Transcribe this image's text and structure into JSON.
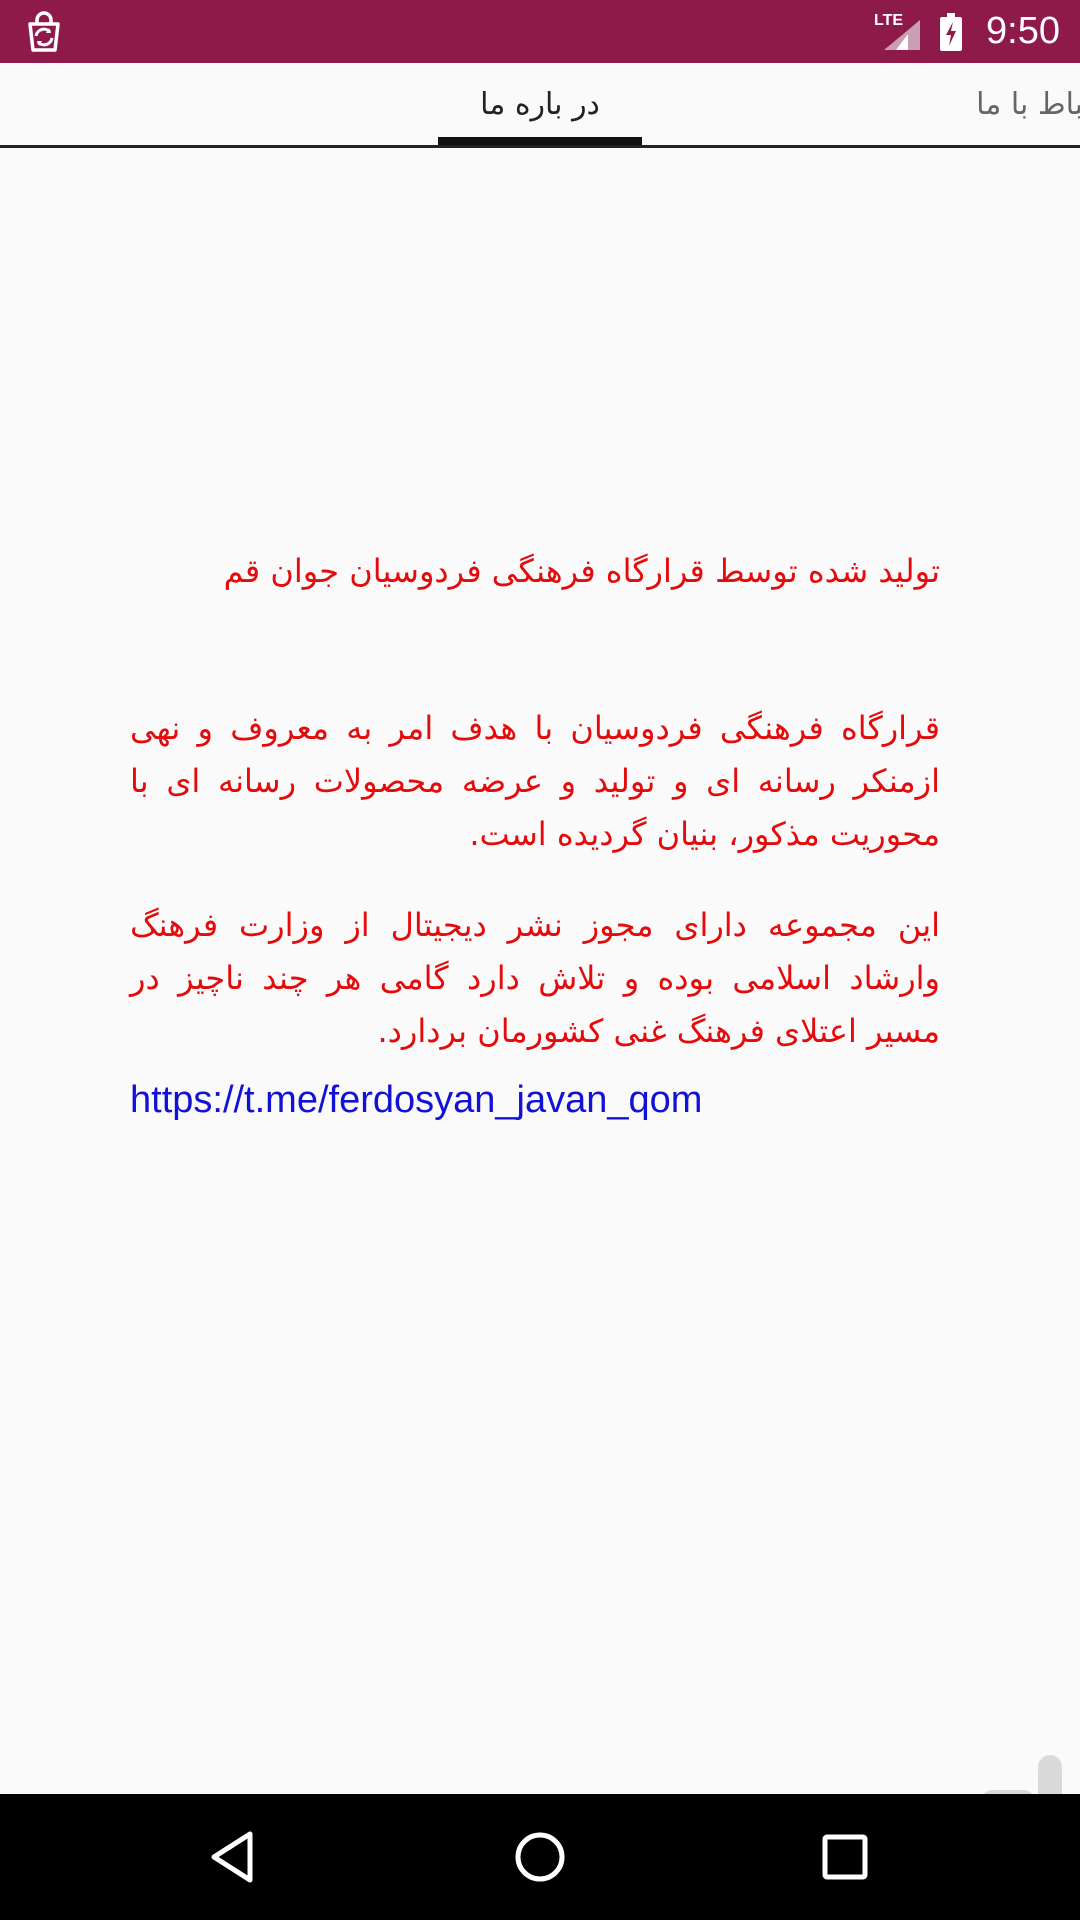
{
  "status_bar": {
    "time": "9:50",
    "network": "LTE",
    "app_icon": "shopping-bag-refresh-icon",
    "signal_icon": "cellular-signal-icon",
    "battery_icon": "battery-charging-icon",
    "color": "#8e1a4a"
  },
  "tabs": [
    {
      "label": "در باره ما",
      "selected": true
    },
    {
      "label": "ارتباط با ما",
      "selected": false
    }
  ],
  "content": {
    "produced_by": "تولید شده توسط قرارگاه فرهنگی فردوسیان جوان قم",
    "paragraph1": "قرارگاه فرهنگی فردوسیان با هدف امر به معروف و نهی ازمنکر رسانه ای و تولید و عرضه محصولات رسانه ای با محوریت مذکور، بنیان گردیده است.",
    "paragraph2": "این مجموعه دارای مجوز نشر دیجیتال از وزارت فرهنگ وارشاد اسلامی بوده و تلاش دارد گامی هر چند ناچیز در مسیر اعتلای فرهنگ غنی کشورمان بردارد.",
    "link": "https://t.me/ferdosyan_javan_qom",
    "text_color": "#e30b0b",
    "link_color": "#1212d6"
  },
  "watermark": {
    "icon": "bazaar-logo-icon"
  },
  "nav_bar": {
    "back_icon": "back-triangle-icon",
    "home_icon": "home-circle-icon",
    "recents_icon": "recents-square-icon"
  }
}
